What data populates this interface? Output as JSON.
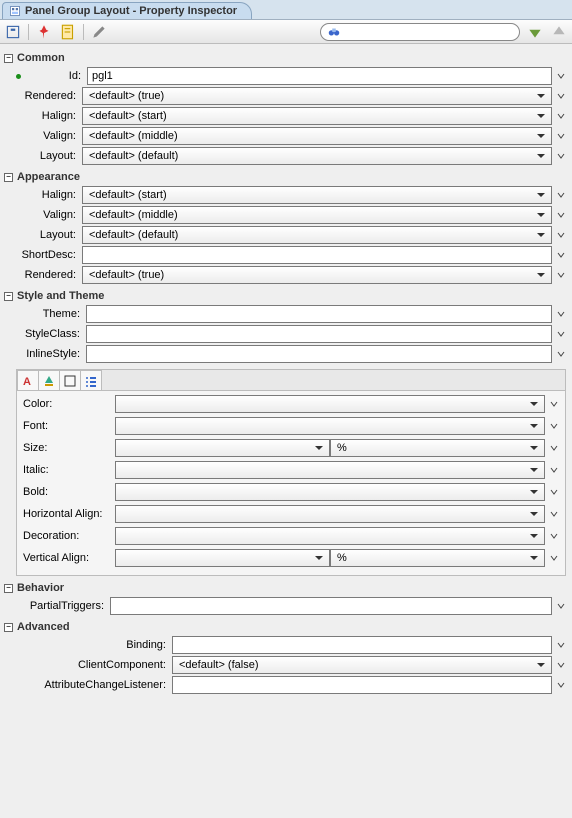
{
  "tab_title": "Panel Group Layout - Property Inspector",
  "sections": {
    "common": {
      "title": "Common",
      "id_label": "Id:",
      "id_value": "pgl1",
      "rendered_label": "Rendered:",
      "rendered_value": "<default> (true)",
      "halign_label": "Halign:",
      "halign_value": "<default> (start)",
      "valign_label": "Valign:",
      "valign_value": "<default> (middle)",
      "layout_label": "Layout:",
      "layout_value": "<default> (default)"
    },
    "appearance": {
      "title": "Appearance",
      "halign_label": "Halign:",
      "halign_value": "<default> (start)",
      "valign_label": "Valign:",
      "valign_value": "<default> (middle)",
      "layout_label": "Layout:",
      "layout_value": "<default> (default)",
      "shortdesc_label": "ShortDesc:",
      "shortdesc_value": "",
      "rendered_label": "Rendered:",
      "rendered_value": "<default> (true)"
    },
    "style": {
      "title": "Style and Theme",
      "theme_label": "Theme:",
      "theme_value": "",
      "styleclass_label": "StyleClass:",
      "styleclass_value": "",
      "inlinestyle_label": "InlineStyle:",
      "inlinestyle_value": "",
      "panel": {
        "color_label": "Color:",
        "font_label": "Font:",
        "size_label": "Size:",
        "size_unit": "%",
        "italic_label": "Italic:",
        "bold_label": "Bold:",
        "halign_label": "Horizontal Align:",
        "decoration_label": "Decoration:",
        "valign_label": "Vertical Align:",
        "valign_unit": "%"
      }
    },
    "behavior": {
      "title": "Behavior",
      "partial_label": "PartialTriggers:",
      "partial_value": ""
    },
    "advanced": {
      "title": "Advanced",
      "binding_label": "Binding:",
      "binding_value": "",
      "clientcomp_label": "ClientComponent:",
      "clientcomp_value": "<default> (false)",
      "attrlistener_label": "AttributeChangeListener:",
      "attrlistener_value": ""
    }
  }
}
